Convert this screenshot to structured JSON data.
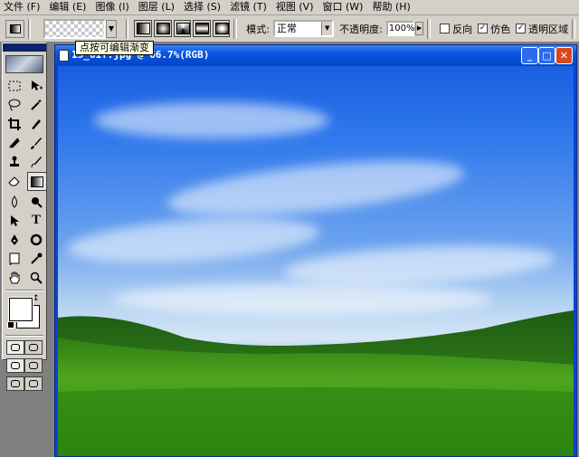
{
  "menu": [
    "文件 (F)",
    "编辑 (E)",
    "图像 (I)",
    "图层 (L)",
    "选择 (S)",
    "滤镜 (T)",
    "视图 (V)",
    "窗口 (W)",
    "帮助 (H)"
  ],
  "options": {
    "mode_label": "模式:",
    "mode_value": "正常",
    "opacity_label": "不透明度:",
    "opacity_value": "100%",
    "reverse_label": "反向",
    "reverse_checked": false,
    "dither_label": "仿色",
    "dither_checked": true,
    "transparency_label": "透明区域",
    "transparency_checked": true
  },
  "tooltip": "点按可编辑渐变",
  "document": {
    "title": "15_61f.jpg @ 66.7%(RGB)"
  },
  "tools": [
    "marquee-icon",
    "move-icon",
    "lasso-icon",
    "magic-wand-icon",
    "crop-icon",
    "slice-icon",
    "healing-brush-icon",
    "brush-icon",
    "clone-stamp-icon",
    "history-brush-icon",
    "eraser-icon",
    "gradient-icon",
    "blur-icon",
    "dodge-icon",
    "path-select-icon",
    "type-icon",
    "pen-icon",
    "shape-icon",
    "notes-icon",
    "eyedropper-icon",
    "hand-icon",
    "zoom-icon"
  ],
  "colors": {
    "foreground": "#ffffff",
    "background": "#ffffff",
    "title_bar": "#0a55e0"
  }
}
